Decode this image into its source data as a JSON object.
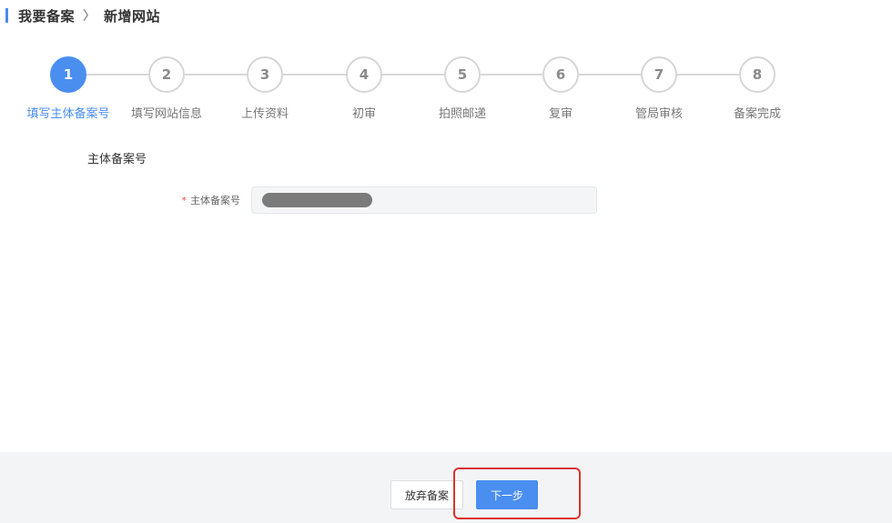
{
  "breadcrumb": {
    "items": [
      "我要备案",
      "新增网站"
    ],
    "separator": "〉"
  },
  "steps": {
    "active_index": 0,
    "items": [
      {
        "number": "1",
        "label": "填写主体备案号"
      },
      {
        "number": "2",
        "label": "填写网站信息"
      },
      {
        "number": "3",
        "label": "上传资料"
      },
      {
        "number": "4",
        "label": "初审"
      },
      {
        "number": "5",
        "label": "拍照邮递"
      },
      {
        "number": "6",
        "label": "复审"
      },
      {
        "number": "7",
        "label": "管局审核"
      },
      {
        "number": "8",
        "label": "备案完成"
      }
    ]
  },
  "form": {
    "section_title": "主体备案号",
    "field": {
      "required_mark": "*",
      "label": "主体备案号",
      "value_redacted": true
    }
  },
  "footer": {
    "abandon_label": "放弃备案",
    "next_label": "下一步"
  },
  "colors": {
    "accent": "#4a8ef0",
    "highlight": "#d9342b",
    "required": "#e05050"
  }
}
